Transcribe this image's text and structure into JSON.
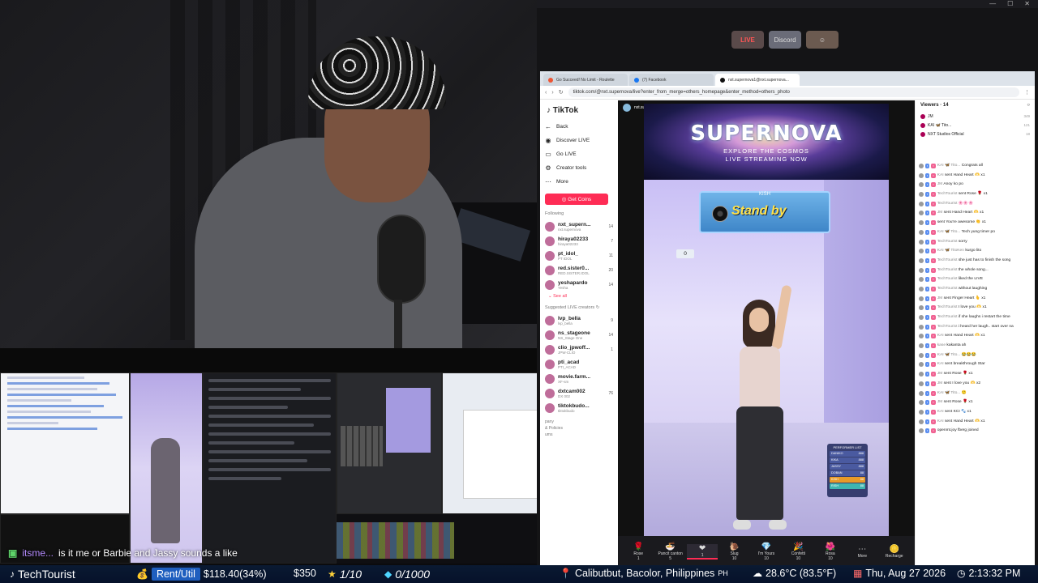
{
  "chat_overlay": {
    "user": "itsme...",
    "message": "is it me or Barbie and Jassy sounds a like"
  },
  "dock": {
    "items": [
      "LIVE",
      "Discord",
      ""
    ]
  },
  "browser": {
    "tabs": [
      "Go Succeed! No Limit - Roulette",
      "(7) Facebook",
      "nxt.supernova1@nxt.supernova..."
    ],
    "url": "tiktok.com/@nxt.supernova/live?enter_from_merge=others_homepage&enter_method=others_photo"
  },
  "sidebar": {
    "logo": "TikTok",
    "back": "Back",
    "nav": [
      "Discover LIVE",
      "Go LIVE",
      "Creator tools",
      "More"
    ],
    "get_coins": "Get Coins",
    "following_label": "Following",
    "following": [
      {
        "name": "nxt_supern...",
        "sub": "nxt.supernova",
        "count": "14"
      },
      {
        "name": "hiraya02233",
        "sub": "hiraya02233",
        "count": "7"
      },
      {
        "name": "pt_idol_",
        "sub": "PT IDOL",
        "count": "11"
      },
      {
        "name": "red.sister0...",
        "sub": "RED.SISTER.IDOL",
        "count": "20"
      },
      {
        "name": "yeshapardo",
        "sub": "Yesha",
        "count": "14"
      }
    ],
    "see_all": "See all",
    "suggested_label": "Suggested LIVE creators",
    "suggested": [
      {
        "name": "lvp_bella",
        "sub": "lvp_bella",
        "count": "9"
      },
      {
        "name": "ns_stageone",
        "sub": "NS_Stage One",
        "count": "14"
      },
      {
        "name": "clio_jpwoff...",
        "sub": "JPW-CLIO",
        "count": "1"
      },
      {
        "name": "pti_acad",
        "sub": "PTI_ACAD",
        "count": ""
      },
      {
        "name": "movie.farm...",
        "sub": "XF-sm",
        "count": ""
      },
      {
        "name": "dxtcam002",
        "sub": "DX 002",
        "count": "76"
      },
      {
        "name": "tiktokbudo...",
        "sub": "tiktokbudo",
        "count": ""
      }
    ],
    "footer": [
      "pany",
      "& Policies",
      "ums"
    ]
  },
  "player": {
    "host": "nxt.supernova",
    "banner_title": "SUPERNOVA",
    "banner_sub1": "EXPLORE THE COSMOS",
    "banner_sub2": "LIVE STREAMING NOW",
    "standby_label": "KISH",
    "standby_text": "Stand by",
    "score": "0",
    "performer_list_title": "PERFORMER LIST",
    "performers": [
      {
        "name": "DANIKO",
        "score": "888"
      },
      {
        "name": "KIKA",
        "score": "888"
      },
      {
        "name": "JASSY",
        "score": "888"
      },
      {
        "name": "DOBAN",
        "score": "88"
      },
      {
        "name": "KISH",
        "score": "88"
      },
      {
        "name": "RISH",
        "score": "88"
      }
    ],
    "gifts": [
      {
        "name": "Rose",
        "sub": "1"
      },
      {
        "name": "Pancit canton",
        "sub": "5"
      },
      {
        "name": "",
        "sub": "1"
      },
      {
        "name": "Slug",
        "sub": "10"
      },
      {
        "name": "I'm Yours",
        "sub": "10"
      },
      {
        "name": "Confetti",
        "sub": "10"
      },
      {
        "name": "Rosa",
        "sub": "10"
      },
      {
        "name": "More",
        "sub": ""
      },
      {
        "name": "Recharge",
        "sub": ""
      }
    ]
  },
  "chat": {
    "viewers_label": "Viewers · 14",
    "viewers": [
      {
        "name": "JM",
        "num": "349"
      },
      {
        "name": "KAI 🦋 Tito...",
        "num": "121"
      },
      {
        "name": "NXT Studios Official",
        "num": "18"
      }
    ],
    "messages": [
      {
        "nm": "KAI 🦋 Tito...",
        "msg": "Congrats all"
      },
      {
        "nm": "KAI",
        "msg": "sent Hand Heart 🫶 x1"
      },
      {
        "nm": "JM",
        "msg": "Anoy ko po"
      },
      {
        "nm": "TechTourist",
        "msg": "sent Rose 🌹 x1"
      },
      {
        "nm": "TechTourist",
        "msg": "🌸🌸🌸"
      },
      {
        "nm": "JM",
        "msg": "sent Hand Heart 🫶 x1"
      },
      {
        "nm": "",
        "msg": "sent You're awesome 👏 x1"
      },
      {
        "nm": "KAI 🦋 Tito...",
        "msg": "Tech yung timer po"
      },
      {
        "nm": "TechTourist",
        "msg": "sorry"
      },
      {
        "nm": "KAI 🦋 TitoKen",
        "msg": "kurgo lito"
      },
      {
        "nm": "TechTourist",
        "msg": "she just has to finish the song"
      },
      {
        "nm": "TechTourist",
        "msg": "the whole song..."
      },
      {
        "nm": "TechTourist",
        "msg": "liked the LIVE"
      },
      {
        "nm": "TechTourist",
        "msg": "without laughing"
      },
      {
        "nm": "JM",
        "msg": "sent Finger Heart 🫰 x1"
      },
      {
        "nm": "TechTourist",
        "msg": "I love you 🫶 x1"
      },
      {
        "nm": "TechTourist",
        "msg": "if she laughs i restart the time"
      },
      {
        "nm": "TechTourist",
        "msg": "i heard her laugh.. start over na"
      },
      {
        "nm": "KAI",
        "msg": "sent Hand Heart 🫶 x1"
      },
      {
        "nm": "kase",
        "msg": "kakanta ah"
      },
      {
        "nm": "KAI 🦋 Tito...",
        "msg": "😂😂😂"
      },
      {
        "nm": "KAI",
        "msg": "sent breakthrough Star"
      },
      {
        "nm": "JM",
        "msg": "sent Rose 🌹 x1"
      },
      {
        "nm": "JM",
        "msg": "sent I love you 🫶 x2"
      },
      {
        "nm": "KAI 🦋 Tito...",
        "msg": "🙂"
      },
      {
        "nm": "JM",
        "msg": "sent Rose 🌹 x1"
      },
      {
        "nm": "KAI",
        "msg": "sent KCI 🐾 x1"
      },
      {
        "nm": "KAI",
        "msg": "sent Hand Heart 🫶 x1"
      },
      {
        "nm": "",
        "msg": "openmt.joy fberg joined"
      }
    ]
  },
  "statusbar": {
    "channel": "TechTourist",
    "rent_label": "Rent/Util",
    "rent_value": "$118.40(34%)",
    "amount": "$350",
    "stars": "1/10",
    "gems": "0/1000",
    "location": "Calibutbut, Bacolor, Philippines",
    "country": "PH",
    "weather": "28.6°C (83.5°F)",
    "date": "Thu, Aug 27 2026",
    "time": "2:13:32 PM"
  }
}
